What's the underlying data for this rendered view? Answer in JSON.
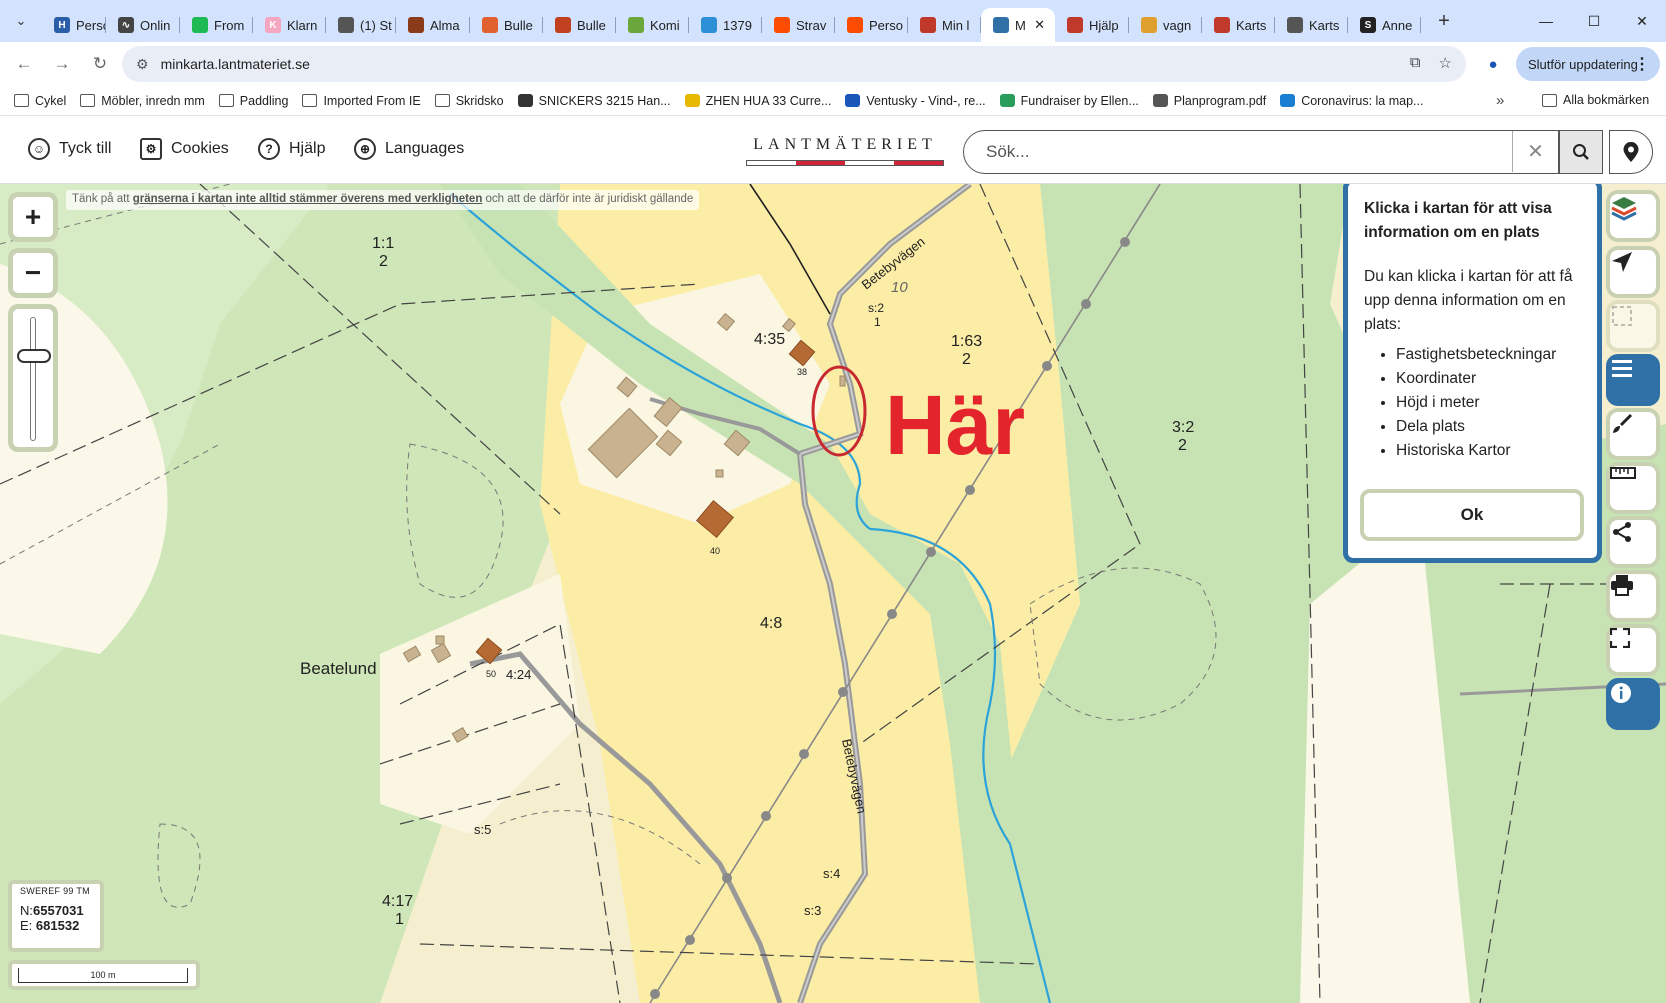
{
  "browser": {
    "tabs": [
      {
        "label": "Perso",
        "color": "#2a5ea8",
        "glyph": "H"
      },
      {
        "label": "Onlin",
        "color": "#444",
        "glyph": "∿"
      },
      {
        "label": "From",
        "color": "#1db954",
        "glyph": ""
      },
      {
        "label": "Klarn",
        "color": "#f5a6c1",
        "glyph": "K"
      },
      {
        "label": "(1) St",
        "color": "#555",
        "glyph": ""
      },
      {
        "label": "Alma",
        "color": "#8b3a1a",
        "glyph": ""
      },
      {
        "label": "Bulle",
        "color": "#e06030",
        "glyph": ""
      },
      {
        "label": "Bulle",
        "color": "#c04020",
        "glyph": ""
      },
      {
        "label": "Komi",
        "color": "#6aa63a",
        "glyph": ""
      },
      {
        "label": "1379",
        "color": "#2d8fd5",
        "glyph": ""
      },
      {
        "label": "Strav",
        "color": "#fc4c02",
        "glyph": ""
      },
      {
        "label": "Perso",
        "color": "#fc4c02",
        "glyph": ""
      },
      {
        "label": "Min l",
        "color": "#c0392b",
        "glyph": ""
      },
      {
        "label": "M",
        "color": "#2f70a6",
        "glyph": "",
        "active": true
      },
      {
        "label": "Hjälp",
        "color": "#c0392b",
        "glyph": ""
      },
      {
        "label": "vagn",
        "color": "#e0a030",
        "glyph": ""
      },
      {
        "label": "Karts",
        "color": "#c0392b",
        "glyph": ""
      },
      {
        "label": "Karts",
        "color": "#555",
        "glyph": ""
      },
      {
        "label": "Anne",
        "color": "#222",
        "glyph": "S"
      }
    ],
    "url": "minkarta.lantmateriet.se",
    "update_label": "Slutför uppdatering",
    "bookmarks": [
      {
        "label": "Cykel",
        "type": "folder"
      },
      {
        "label": "Möbler, inredn mm",
        "type": "folder"
      },
      {
        "label": "Paddling",
        "type": "folder"
      },
      {
        "label": "Imported From IE",
        "type": "folder"
      },
      {
        "label": "Skridsko",
        "type": "folder"
      },
      {
        "label": "SNICKERS 3215 Han...",
        "type": "site"
      },
      {
        "label": "ZHEN HUA 33 Curre...",
        "type": "site"
      },
      {
        "label": "Ventusky - Vind-, re...",
        "type": "site"
      },
      {
        "label": "Fundraiser by Ellen...",
        "type": "site"
      },
      {
        "label": "Planprogram.pdf",
        "type": "site"
      },
      {
        "label": "Coronavirus: la map...",
        "type": "site"
      }
    ],
    "all_bookmarks": "Alla bokmärken"
  },
  "header": {
    "feedback": "Tyck till",
    "cookies": "Cookies",
    "help": "Hjälp",
    "languages": "Languages",
    "logo": "LANTMÄTERIET",
    "search_placeholder": "Sök..."
  },
  "map": {
    "disclaimer_pre": "Tänk på att ",
    "disclaimer_link": "gränserna i kartan inte alltid stämmer överens med verkligheten",
    "disclaimer_post": " och att de därför inte är juridiskt gällande",
    "annotation": "Här",
    "labels": {
      "p_1_1": "1:1",
      "p_1_1b": "2",
      "p_4_35": "4:35",
      "p_1_63": "1:63",
      "p_1_63b": "2",
      "p_3_2": "3:2",
      "p_3_2b": "2",
      "p_4_8": "4:8",
      "p_4_24": "4:24",
      "p_4_17": "4:17",
      "p_4_17b": "1",
      "p_s2": "s:2",
      "p_s2b": "1",
      "p_s4": "s:4",
      "p_s5": "s:5",
      "p_s3": "s:3",
      "num_10": "10",
      "num_38": "38",
      "num_40": "40",
      "num_50": "50",
      "place": "Beatelund",
      "road1": "Betebyvägen",
      "road2": "Betebyvägen"
    },
    "coord_system": "SWEREF 99 TM",
    "north_label": "N:",
    "north": "6557031",
    "east_label": "E:",
    "east": "681532",
    "scale": "100 m",
    "zoom_level": 0.28
  },
  "info_panel": {
    "title": "Klicka i kartan för att visa information om en plats",
    "body": "Du kan klicka i kartan för att få upp denna information om en plats:",
    "items": [
      "Fastighetsbeteckningar",
      "Koordinater",
      "Höjd i meter",
      "Dela plats",
      "Historiska Kartor"
    ],
    "ok": "Ok"
  },
  "colors": {
    "accent": "#2f70a6",
    "forest": "#c8e3b3",
    "field": "#fbeda6",
    "annotation": "#e4242c"
  }
}
